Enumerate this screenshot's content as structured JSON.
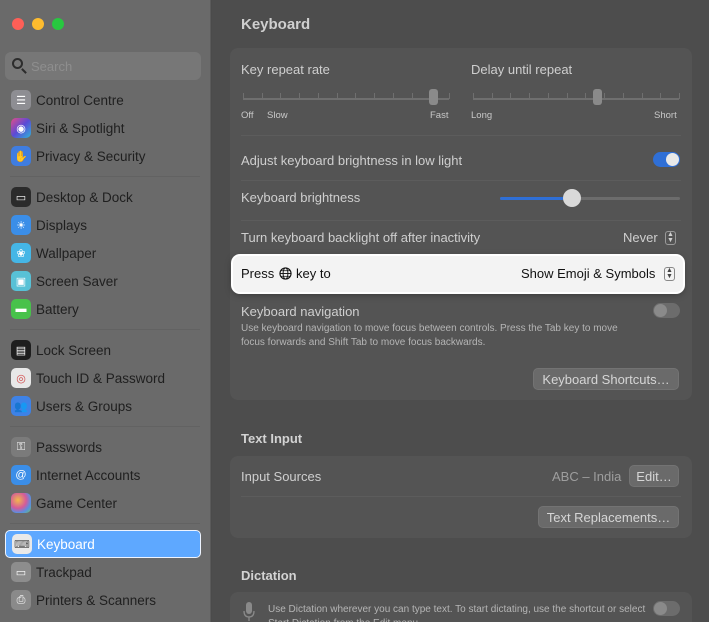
{
  "window": {
    "traffic_lights": {
      "close": "#fe5f57",
      "minimize": "#febc2e",
      "zoom": "#28c840"
    }
  },
  "search": {
    "placeholder": "Search"
  },
  "sidebar": {
    "items": [
      {
        "label": "Control Centre",
        "icon": "control-centre-icon",
        "color": "#8e8e93"
      },
      {
        "label": "Siri & Spotlight",
        "icon": "siri-icon",
        "color": "#c44bd6"
      },
      {
        "label": "Privacy & Security",
        "icon": "hand-icon",
        "color": "#3f7de0"
      },
      {
        "label": "Desktop & Dock",
        "icon": "dock-icon",
        "color": "#2b2b2b"
      },
      {
        "label": "Displays",
        "icon": "display-icon",
        "color": "#3b8ee8"
      },
      {
        "label": "Wallpaper",
        "icon": "wallpaper-icon",
        "color": "#45b6e6"
      },
      {
        "label": "Screen Saver",
        "icon": "screen-saver-icon",
        "color": "#58c1d6"
      },
      {
        "label": "Battery",
        "icon": "battery-icon",
        "color": "#48c24b"
      },
      {
        "label": "Lock Screen",
        "icon": "lock-icon",
        "color": "#1e1e1e"
      },
      {
        "label": "Touch ID & Password",
        "icon": "fingerprint-icon",
        "color": "#d24a4a"
      },
      {
        "label": "Users & Groups",
        "icon": "users-icon",
        "color": "#3e82e6"
      },
      {
        "label": "Passwords",
        "icon": "key-icon",
        "color": "#7b7b7b"
      },
      {
        "label": "Internet Accounts",
        "icon": "at-icon",
        "color": "#3b8ee8"
      },
      {
        "label": "Game Center",
        "icon": "game-center-icon",
        "color": "#9b7bd4"
      },
      {
        "label": "Keyboard",
        "icon": "keyboard-icon",
        "color": "#9a9a9a",
        "selected": true
      },
      {
        "label": "Trackpad",
        "icon": "trackpad-icon",
        "color": "#8d8d8d"
      },
      {
        "label": "Printers & Scanners",
        "icon": "printer-icon",
        "color": "#8a8a8a"
      }
    ]
  },
  "main": {
    "title": "Keyboard",
    "key_repeat": {
      "label": "Key repeat rate",
      "min": "Off",
      "slow": "Slow",
      "max": "Fast",
      "level": 0.92
    },
    "delay_repeat": {
      "label": "Delay until repeat",
      "min": "Long",
      "max": "Short",
      "level": 0.6
    },
    "adjust_brightness": {
      "label": "Adjust keyboard brightness in low light",
      "on": true
    },
    "brightness": {
      "label": "Keyboard brightness",
      "level": 0.4
    },
    "backlight_off": {
      "label": "Turn keyboard backlight off after inactivity",
      "value": "Never"
    },
    "press_key": {
      "label_before": "Press",
      "label_after": "key to",
      "value": "Show Emoji & Symbols"
    },
    "keyboard_navigation": {
      "label": "Keyboard navigation",
      "description": "Use keyboard navigation to move focus between controls. Press the Tab key to move focus forwards and Shift Tab to move focus backwards.",
      "on": false
    },
    "shortcuts_button": "Keyboard Shortcuts…",
    "text_input": {
      "title": "Text Input",
      "input_sources_label": "Input Sources",
      "input_sources_value": "ABC – India",
      "edit_button": "Edit…",
      "replacements_button": "Text Replacements…"
    },
    "dictation": {
      "title": "Dictation",
      "description": "Use Dictation wherever you can type text. To start dictating, use the shortcut or select Start Dictation from the Edit menu.",
      "on": false
    }
  }
}
